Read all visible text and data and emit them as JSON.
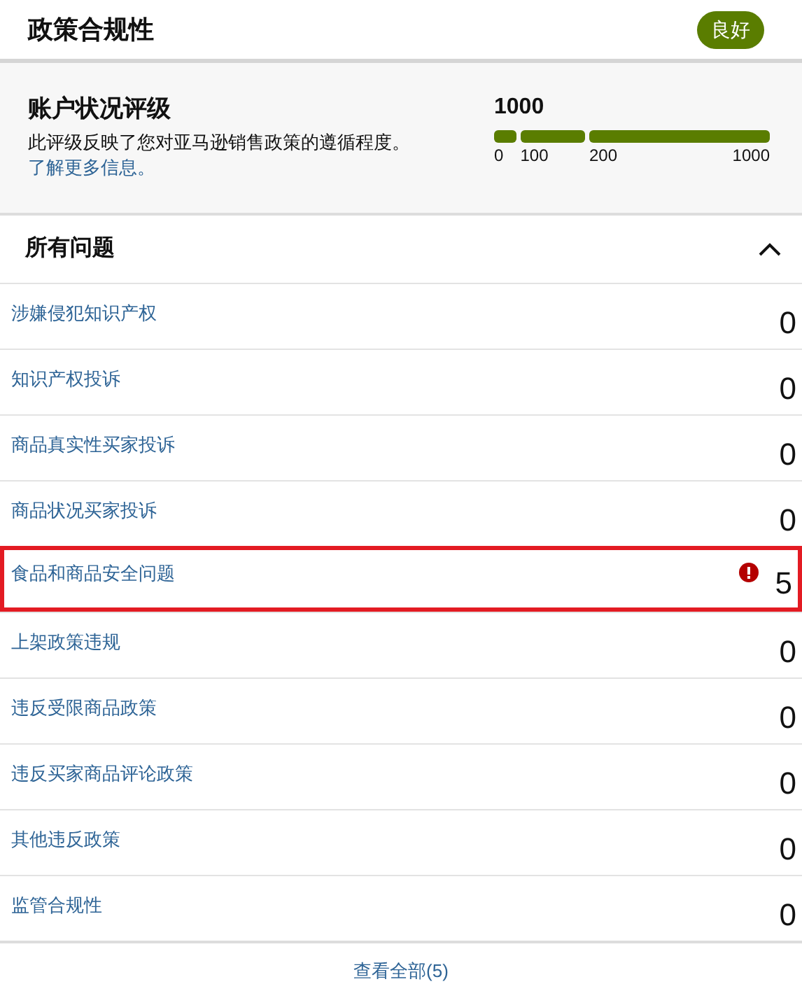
{
  "header": {
    "title": "政策合规性",
    "status_badge": "良好"
  },
  "rating": {
    "title": "账户状况评级",
    "description": "此评级反映了您对亚马逊销售政策的遵循程度。",
    "link": "了解更多信息。",
    "score": "1000",
    "level": 1,
    "ticks": [
      "0",
      "100",
      "200",
      "1000"
    ]
  },
  "issues": {
    "title": "所有问题",
    "expanded": true,
    "rows": [
      {
        "label": "涉嫌侵犯知识产权",
        "count": "0",
        "flagged": false
      },
      {
        "label": "知识产权投诉",
        "count": "0",
        "flagged": false
      },
      {
        "label": "商品真实性买家投诉",
        "count": "0",
        "flagged": false
      },
      {
        "label": "商品状况买家投诉",
        "count": "0",
        "flagged": false
      },
      {
        "label": "食品和商品安全问题",
        "count": "5",
        "flagged": true
      },
      {
        "label": "上架政策违规",
        "count": "0",
        "flagged": false
      },
      {
        "label": "违反受限商品政策",
        "count": "0",
        "flagged": false
      },
      {
        "label": "违反买家商品评论政策",
        "count": "0",
        "flagged": false
      },
      {
        "label": "其他违反政策",
        "count": "0",
        "flagged": false
      },
      {
        "label": "监管合规性",
        "count": "0",
        "flagged": false
      }
    ]
  },
  "footer": {
    "link": "查看全部(5)"
  }
}
